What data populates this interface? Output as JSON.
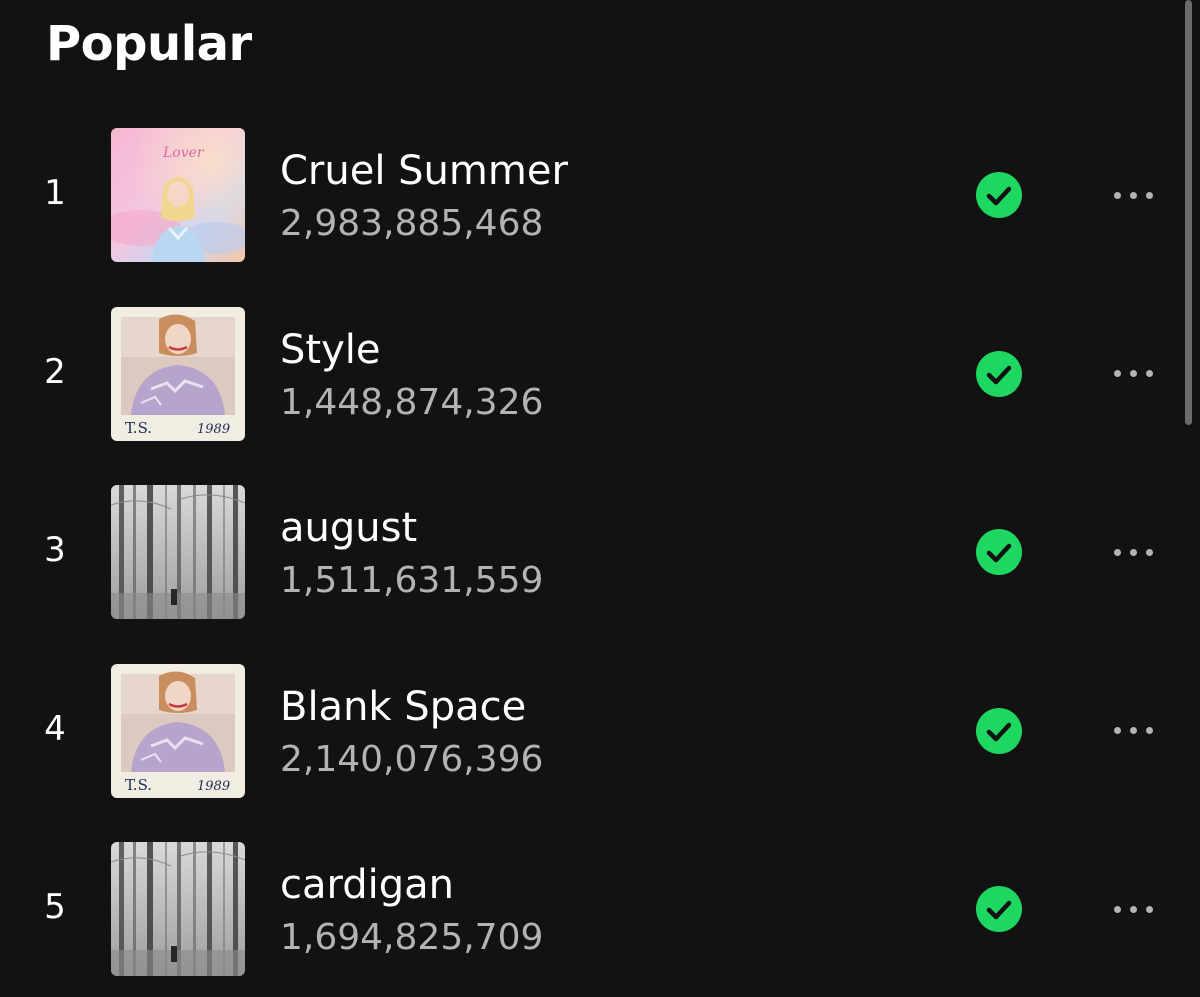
{
  "section": {
    "title": "Popular"
  },
  "tracks": [
    {
      "rank": "1",
      "title": "Cruel Summer",
      "plays": "2,983,885,468",
      "cover": "lover-album-cover"
    },
    {
      "rank": "2",
      "title": "Style",
      "plays": "1,448,874,326",
      "cover": "1989-album-cover"
    },
    {
      "rank": "3",
      "title": "august",
      "plays": "1,511,631,559",
      "cover": "folklore-album-cover"
    },
    {
      "rank": "4",
      "title": "Blank Space",
      "plays": "2,140,076,396",
      "cover": "1989-album-cover"
    },
    {
      "rank": "5",
      "title": "cardigan",
      "plays": "1,694,825,709",
      "cover": "folklore-album-cover"
    }
  ],
  "covers": {
    "lover_script": "Lover",
    "caption_left": "T.S.",
    "caption_right": "1989"
  },
  "icons": {
    "saved": "check-circle-icon",
    "more": "more-horizontal-icon"
  },
  "colors": {
    "background": "#121212",
    "accent": "#1ed760",
    "text_primary": "#ffffff",
    "text_secondary": "#b3b3b3"
  }
}
